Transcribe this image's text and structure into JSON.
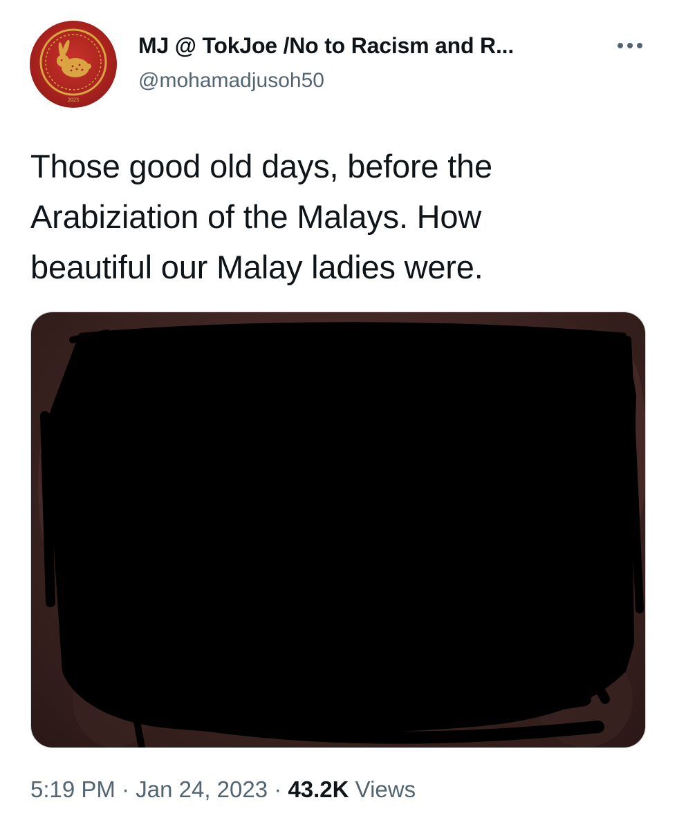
{
  "tweet": {
    "author": {
      "display_name": "MJ @ TokJoe /No to Racism and R...",
      "handle": "@mohamadjusoh50",
      "avatar_year": "2023"
    },
    "more_icon": "more-horizontal-icon",
    "text": "Those good old days, before the\nArabiziation of the Malays. How\nbeautiful our Malay ladies were.",
    "meta": {
      "time": "5:19 PM",
      "separator": "·",
      "date": "Jan 24, 2023",
      "views_count": "43.2K",
      "views_label": "Views"
    },
    "colors": {
      "text": "#0f1419",
      "secondary": "#536471",
      "avatar_red": "#a5211d",
      "avatar_gold": "#d9a441"
    }
  }
}
